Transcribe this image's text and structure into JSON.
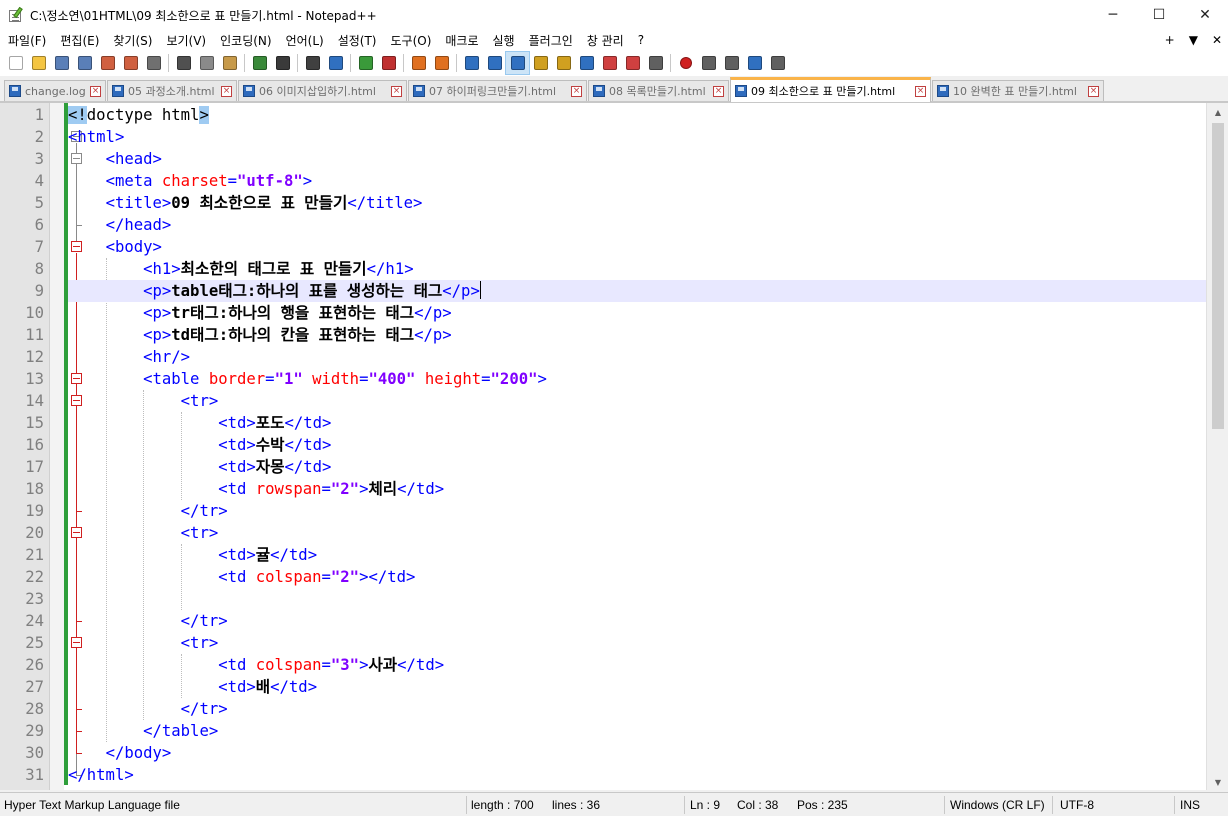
{
  "window": {
    "title": "C:\\정소연\\01HTML\\09 최소한으로 표 만들기.html - Notepad++",
    "minimize_glyph": "─",
    "maximize_glyph": "☐",
    "close_glyph": "✕"
  },
  "menu": {
    "items": [
      "파일(F)",
      "편집(E)",
      "찾기(S)",
      "보기(V)",
      "인코딩(N)",
      "언어(L)",
      "설정(T)",
      "도구(O)",
      "매크로",
      "실행",
      "플러그인",
      "창 관리",
      "?"
    ],
    "right_items": [
      "+",
      "▼",
      "✕"
    ]
  },
  "toolbar": {
    "buttons": [
      {
        "name": "new-file",
        "color": "#ffffff"
      },
      {
        "name": "open-file",
        "color": "#f4c542"
      },
      {
        "name": "save",
        "color": "#5a7fb8"
      },
      {
        "name": "save-all",
        "color": "#5a7fb8"
      },
      {
        "name": "close",
        "color": "#d06040"
      },
      {
        "name": "close-all",
        "color": "#d06040"
      },
      {
        "name": "print",
        "color": "#707070"
      },
      {
        "name": "cut",
        "color": "#505050"
      },
      {
        "name": "copy",
        "color": "#8a8a8a"
      },
      {
        "name": "paste",
        "color": "#c79a4a"
      },
      {
        "name": "undo",
        "color": "#3a8a3a"
      },
      {
        "name": "redo",
        "color": "#3a3a3a"
      },
      {
        "name": "find",
        "color": "#404040"
      },
      {
        "name": "replace",
        "color": "#3070c0"
      },
      {
        "name": "zoom-in",
        "color": "#3a9a3a"
      },
      {
        "name": "zoom-out",
        "color": "#c03030"
      },
      {
        "name": "sync-vertical",
        "color": "#e07020"
      },
      {
        "name": "sync-horizontal",
        "color": "#e07020"
      },
      {
        "name": "word-wrap",
        "color": "#3070c0"
      },
      {
        "name": "show-all-chars",
        "color": "#3070c0"
      },
      {
        "name": "indent-guide",
        "color": "#3070c0"
      },
      {
        "name": "udl",
        "color": "#d0a020"
      },
      {
        "name": "doc-map",
        "color": "#d0a020"
      },
      {
        "name": "function-list",
        "color": "#3070c0"
      },
      {
        "name": "folder-workspace",
        "color": "#d04040"
      },
      {
        "name": "monitoring",
        "color": "#d04040"
      },
      {
        "name": "doc-switcher",
        "color": "#606060"
      },
      {
        "name": "record-macro",
        "color": "#d02020"
      },
      {
        "name": "stop-record",
        "color": "#606060"
      },
      {
        "name": "play-macro",
        "color": "#606060"
      },
      {
        "name": "play-multiple",
        "color": "#3070c0"
      },
      {
        "name": "save-macro",
        "color": "#606060"
      }
    ]
  },
  "tabs": [
    {
      "label": "change.log",
      "active": false
    },
    {
      "label": "05 과정소개.html",
      "active": false
    },
    {
      "label": "06 이미지삽입하기.html",
      "active": false
    },
    {
      "label": "07 하이퍼링크만들기.html",
      "active": false
    },
    {
      "label": "08 목록만들기.html",
      "active": false
    },
    {
      "label": "09 최소한으로 표 만들기.html",
      "active": true
    },
    {
      "label": "10 완벽한 표 만들기.html",
      "active": false
    }
  ],
  "editor": {
    "current_line": 9,
    "lines": [
      {
        "n": "1",
        "tokens": [
          [
            "doc",
            "<!"
          ],
          [
            "plain",
            "doctype html"
          ],
          [
            "doc",
            ">"
          ]
        ]
      },
      {
        "n": "2",
        "tokens": [
          [
            "tag",
            "<html>"
          ]
        ]
      },
      {
        "n": "3",
        "tokens": [
          [
            "plain",
            "    "
          ],
          [
            "tag",
            "<head>"
          ]
        ]
      },
      {
        "n": "4",
        "tokens": [
          [
            "plain",
            "    "
          ],
          [
            "tag",
            "<meta "
          ],
          [
            "attr",
            "charset"
          ],
          [
            "tag",
            "="
          ],
          [
            "val",
            "\"utf-8\""
          ],
          [
            "tag",
            ">"
          ]
        ]
      },
      {
        "n": "5",
        "tokens": [
          [
            "plain",
            "    "
          ],
          [
            "tag",
            "<title>"
          ],
          [
            "txt",
            "09 최소한으로 표 만들기"
          ],
          [
            "tag",
            "</title>"
          ]
        ]
      },
      {
        "n": "6",
        "tokens": [
          [
            "plain",
            "    "
          ],
          [
            "tag",
            "</head>"
          ]
        ]
      },
      {
        "n": "7",
        "tokens": [
          [
            "plain",
            "    "
          ],
          [
            "tag",
            "<body>"
          ]
        ]
      },
      {
        "n": "8",
        "tokens": [
          [
            "plain",
            "        "
          ],
          [
            "tag",
            "<h1>"
          ],
          [
            "txt",
            "최소한의 태그로 표 만들기"
          ],
          [
            "tag",
            "</h1>"
          ]
        ]
      },
      {
        "n": "9",
        "tokens": [
          [
            "plain",
            "        "
          ],
          [
            "tag",
            "<p>"
          ],
          [
            "txt",
            "table태그:하나의 표를 생성하는 태그"
          ],
          [
            "tag",
            "</p>"
          ]
        ]
      },
      {
        "n": "10",
        "tokens": [
          [
            "plain",
            "        "
          ],
          [
            "tag",
            "<p>"
          ],
          [
            "txt",
            "tr태그:하나의 행을 표현하는 태그"
          ],
          [
            "tag",
            "</p>"
          ]
        ]
      },
      {
        "n": "11",
        "tokens": [
          [
            "plain",
            "        "
          ],
          [
            "tag",
            "<p>"
          ],
          [
            "txt",
            "td태그:하나의 칸을 표현하는 태그"
          ],
          [
            "tag",
            "</p>"
          ]
        ]
      },
      {
        "n": "12",
        "tokens": [
          [
            "plain",
            "        "
          ],
          [
            "tag",
            "<hr/>"
          ]
        ]
      },
      {
        "n": "13",
        "tokens": [
          [
            "plain",
            "        "
          ],
          [
            "tag",
            "<table "
          ],
          [
            "attr",
            "border"
          ],
          [
            "tag",
            "="
          ],
          [
            "val",
            "\"1\""
          ],
          [
            "tag",
            " "
          ],
          [
            "attr",
            "width"
          ],
          [
            "tag",
            "="
          ],
          [
            "val",
            "\"400\""
          ],
          [
            "tag",
            " "
          ],
          [
            "attr",
            "height"
          ],
          [
            "tag",
            "="
          ],
          [
            "val",
            "\"200\""
          ],
          [
            "tag",
            ">"
          ]
        ]
      },
      {
        "n": "14",
        "tokens": [
          [
            "plain",
            "            "
          ],
          [
            "tag",
            "<tr>"
          ]
        ]
      },
      {
        "n": "15",
        "tokens": [
          [
            "plain",
            "                "
          ],
          [
            "tag",
            "<td>"
          ],
          [
            "txt",
            "포도"
          ],
          [
            "tag",
            "</td>"
          ]
        ]
      },
      {
        "n": "16",
        "tokens": [
          [
            "plain",
            "                "
          ],
          [
            "tag",
            "<td>"
          ],
          [
            "txt",
            "수박"
          ],
          [
            "tag",
            "</td>"
          ]
        ]
      },
      {
        "n": "17",
        "tokens": [
          [
            "plain",
            "                "
          ],
          [
            "tag",
            "<td>"
          ],
          [
            "txt",
            "자몽"
          ],
          [
            "tag",
            "</td>"
          ]
        ]
      },
      {
        "n": "18",
        "tokens": [
          [
            "plain",
            "                "
          ],
          [
            "tag",
            "<td "
          ],
          [
            "attr",
            "rowspan"
          ],
          [
            "tag",
            "="
          ],
          [
            "val",
            "\"2\""
          ],
          [
            "tag",
            ">"
          ],
          [
            "txt",
            "체리"
          ],
          [
            "tag",
            "</td>"
          ]
        ]
      },
      {
        "n": "19",
        "tokens": [
          [
            "plain",
            "            "
          ],
          [
            "tag",
            "</tr>"
          ]
        ]
      },
      {
        "n": "20",
        "tokens": [
          [
            "plain",
            "            "
          ],
          [
            "tag",
            "<tr>"
          ]
        ]
      },
      {
        "n": "21",
        "tokens": [
          [
            "plain",
            "                "
          ],
          [
            "tag",
            "<td>"
          ],
          [
            "txt",
            "귤"
          ],
          [
            "tag",
            "</td>"
          ]
        ]
      },
      {
        "n": "22",
        "tokens": [
          [
            "plain",
            "                "
          ],
          [
            "tag",
            "<td "
          ],
          [
            "attr",
            "colspan"
          ],
          [
            "tag",
            "="
          ],
          [
            "val",
            "\"2\""
          ],
          [
            "tag",
            "></td>"
          ]
        ]
      },
      {
        "n": "23",
        "tokens": []
      },
      {
        "n": "24",
        "tokens": [
          [
            "plain",
            "            "
          ],
          [
            "tag",
            "</tr>"
          ]
        ]
      },
      {
        "n": "25",
        "tokens": [
          [
            "plain",
            "            "
          ],
          [
            "tag",
            "<tr>"
          ]
        ]
      },
      {
        "n": "26",
        "tokens": [
          [
            "plain",
            "                "
          ],
          [
            "tag",
            "<td "
          ],
          [
            "attr",
            "colspan"
          ],
          [
            "tag",
            "="
          ],
          [
            "val",
            "\"3\""
          ],
          [
            "tag",
            ">"
          ],
          [
            "txt",
            "사과"
          ],
          [
            "tag",
            "</td>"
          ]
        ]
      },
      {
        "n": "27",
        "tokens": [
          [
            "plain",
            "                "
          ],
          [
            "tag",
            "<td>"
          ],
          [
            "txt",
            "배"
          ],
          [
            "tag",
            "</td>"
          ]
        ]
      },
      {
        "n": "28",
        "tokens": [
          [
            "plain",
            "            "
          ],
          [
            "tag",
            "</tr>"
          ]
        ]
      },
      {
        "n": "29",
        "tokens": [
          [
            "plain",
            "        "
          ],
          [
            "tag",
            "</table>"
          ]
        ]
      },
      {
        "n": "30",
        "tokens": [
          [
            "plain",
            "    "
          ],
          [
            "tag",
            "</body>"
          ]
        ]
      },
      {
        "n": "31",
        "tokens": [
          [
            "tag",
            "</html>"
          ]
        ]
      }
    ]
  },
  "status": {
    "file_type": "Hyper Text Markup Language file",
    "length": "length : 700",
    "lines": "lines : 36",
    "ln": "Ln : 9",
    "col": "Col : 38",
    "pos": "Pos : 235",
    "eol": "Windows (CR LF)",
    "encoding": "UTF-8",
    "mode": "INS"
  }
}
